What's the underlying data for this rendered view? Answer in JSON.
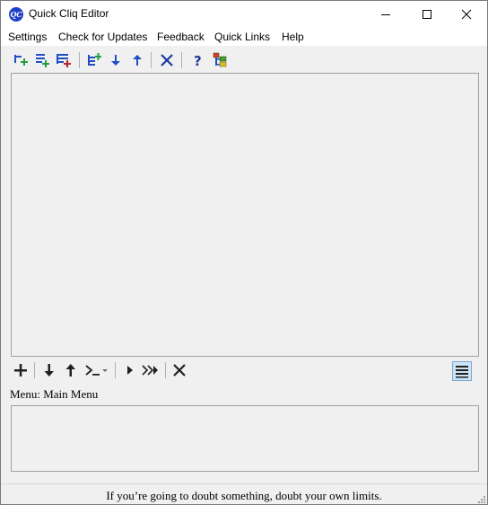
{
  "window": {
    "title": "Quick Cliq Editor"
  },
  "menubar": {
    "items": [
      "Settings",
      "Check for Updates",
      "Feedback",
      "Quick Links",
      "Help"
    ]
  },
  "toolbar": {
    "icons": [
      "add-item-icon",
      "add-submenu-icon",
      "add-menu-icon",
      "add-group-icon",
      "move-down-icon",
      "move-up-icon",
      "delete-icon",
      "help-icon",
      "tree-icon"
    ]
  },
  "bottom_toolbar": {
    "icons": [
      "add-icon",
      "move-down-icon",
      "move-up-icon",
      "command-icon",
      "run-icon",
      "run-all-icon",
      "delete-icon",
      "list-view-icon"
    ]
  },
  "menu_section": {
    "label": "Menu: Main Menu"
  },
  "status": {
    "text": "If you’re going to doubt something, doubt your own limits."
  },
  "colors": {
    "accent": "#1e40c8",
    "panel_border": "#a0a0a0",
    "window_bg": "#f0f0f0"
  }
}
